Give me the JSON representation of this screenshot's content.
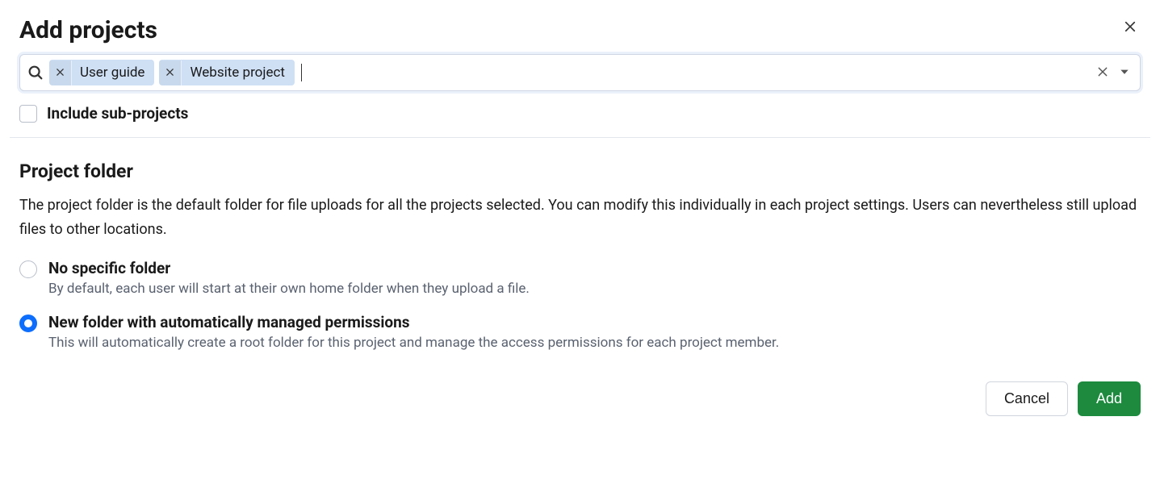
{
  "dialog": {
    "title": "Add projects"
  },
  "search": {
    "chips": [
      {
        "label": "User guide"
      },
      {
        "label": "Website project"
      }
    ],
    "value": ""
  },
  "include_subprojects": {
    "label": "Include sub-projects",
    "checked": false
  },
  "project_folder": {
    "title": "Project folder",
    "description": "The project folder is the default folder for file uploads for all the projects selected. You can modify this individually in each project settings. Users can nevertheless still upload files to other locations.",
    "options": [
      {
        "title": "No specific folder",
        "description": "By default, each user will start at their own home folder when they upload a file.",
        "selected": false
      },
      {
        "title": "New folder with automatically managed permissions",
        "description": "This will automatically create a root folder for this project and manage the access permissions for each project member.",
        "selected": true
      }
    ]
  },
  "footer": {
    "cancel": "Cancel",
    "submit": "Add"
  }
}
